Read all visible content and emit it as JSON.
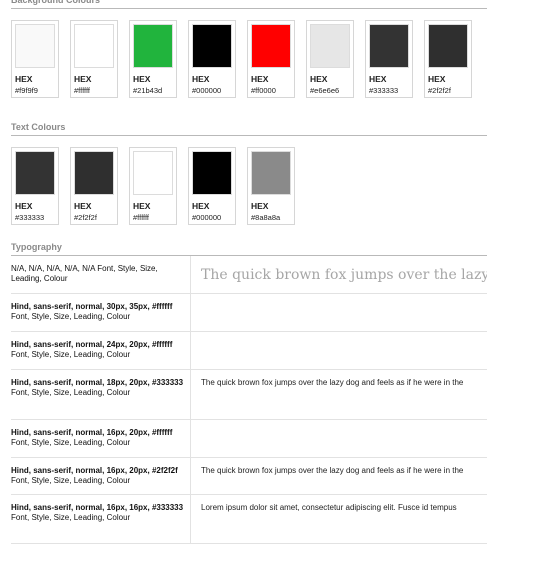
{
  "background": {
    "title": "Background Colours",
    "swatches": [
      {
        "label": "HEX",
        "value": "#f9f9f9",
        "color": "#f9f9f9"
      },
      {
        "label": "HEX",
        "value": "#ffffff",
        "color": "#ffffff"
      },
      {
        "label": "HEX",
        "value": "#21b43d",
        "color": "#21b43d"
      },
      {
        "label": "HEX",
        "value": "#000000",
        "color": "#000000"
      },
      {
        "label": "HEX",
        "value": "#ff0000",
        "color": "#ff0000"
      },
      {
        "label": "HEX",
        "value": "#e6e6e6",
        "color": "#e6e6e6"
      },
      {
        "label": "HEX",
        "value": "#333333",
        "color": "#333333"
      },
      {
        "label": "HEX",
        "value": "#2f2f2f",
        "color": "#2f2f2f"
      }
    ]
  },
  "text_colours": {
    "title": "Text Colours",
    "swatches": [
      {
        "label": "HEX",
        "value": "#333333",
        "color": "#333333"
      },
      {
        "label": "HEX",
        "value": "#2f2f2f",
        "color": "#2f2f2f"
      },
      {
        "label": "HEX",
        "value": "#ffffff",
        "color": "#ffffff"
      },
      {
        "label": "HEX",
        "value": "#000000",
        "color": "#000000"
      },
      {
        "label": "HEX",
        "value": "#8a8a8a",
        "color": "#8a8a8a"
      }
    ]
  },
  "typography": {
    "title": "Typography",
    "rows": [
      {
        "spec": "N/A, N/A, N/A, N/A, N/A",
        "suffix": " Font, Style, Size, Leading, Colour",
        "sample": "The quick brown fox jumps over the lazy dog",
        "style": "serif-faded"
      },
      {
        "spec": "Hind, sans-serif, normal, 30px, 35px, #ffffff",
        "suffix": " Font, Style, Size, Leading, Colour",
        "sample": ""
      },
      {
        "spec": "Hind, sans-serif, normal, 24px, 20px, #ffffff",
        "suffix": " Font, Style, Size, Leading, Colour",
        "sample": ""
      },
      {
        "spec": "Hind, sans-serif, normal, 18px, 20px, #333333",
        "suffix": " Font, Style, Size, Leading, Colour",
        "sample": "The quick brown fox jumps over the lazy dog and feels as if he were in the"
      },
      {
        "spec": "Hind, sans-serif, normal, 16px, 20px, #ffffff",
        "suffix": " Font, Style, Size, Leading, Colour",
        "sample": ""
      },
      {
        "spec": "Hind, sans-serif, normal, 16px, 20px, #2f2f2f",
        "suffix": " Font, Style, Size, Leading, Colour",
        "sample": "The quick brown fox jumps over the lazy dog and feels as if he were in the"
      },
      {
        "spec": "Hind, sans-serif, normal, 16px, 16px, #333333",
        "suffix": " Font, Style, Size, Leading, Colour",
        "sample": "Lorem ipsum dolor sit amet, consectetur adipiscing elit. Fusce id tempus"
      }
    ]
  }
}
